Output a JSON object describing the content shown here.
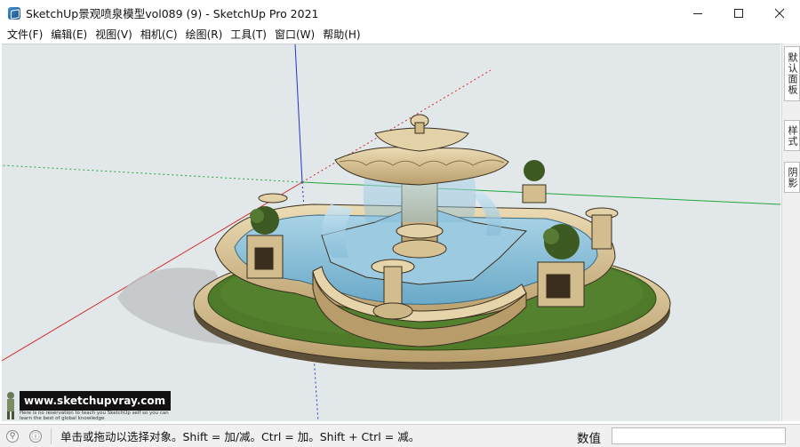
{
  "window": {
    "title": "SketchUp景观喷泉模型vol089 (9) - SketchUp Pro 2021",
    "minimize_glyph": "—",
    "maximize_glyph": "☐",
    "close_glyph": "✕"
  },
  "menu": {
    "items": [
      {
        "label": "文件(F)"
      },
      {
        "label": "编辑(E)"
      },
      {
        "label": "视图(V)"
      },
      {
        "label": "相机(C)"
      },
      {
        "label": "绘图(R)"
      },
      {
        "label": "工具(T)"
      },
      {
        "label": "窗口(W)"
      },
      {
        "label": "帮助(H)"
      }
    ]
  },
  "tray": {
    "tabs": [
      {
        "label": "默认面板"
      },
      {
        "label": "样式"
      },
      {
        "label": "阴影"
      }
    ]
  },
  "watermark": {
    "site": "www.sketchupvray.com",
    "tagline": "Here is no reservation to teach you SketchUp self so you can learn the best of global knowledge"
  },
  "statusbar": {
    "geo_icon": "geolocation-icon",
    "info_icon": "info-icon",
    "hint": "单击或拖动以选择对象。Shift = 加/减。Ctrl = 加。Shift + Ctrl = 减。",
    "measurements_label": "数值",
    "measurements_value": ""
  },
  "colors": {
    "viewport_bg": "#e2e7ea",
    "axis_red": "#d12a2a",
    "axis_green": "#1fa83a",
    "axis_blue": "#2433c7",
    "stone": "#d8c59e",
    "water": "#8fc4dc",
    "lawn": "#4f7a2a"
  }
}
